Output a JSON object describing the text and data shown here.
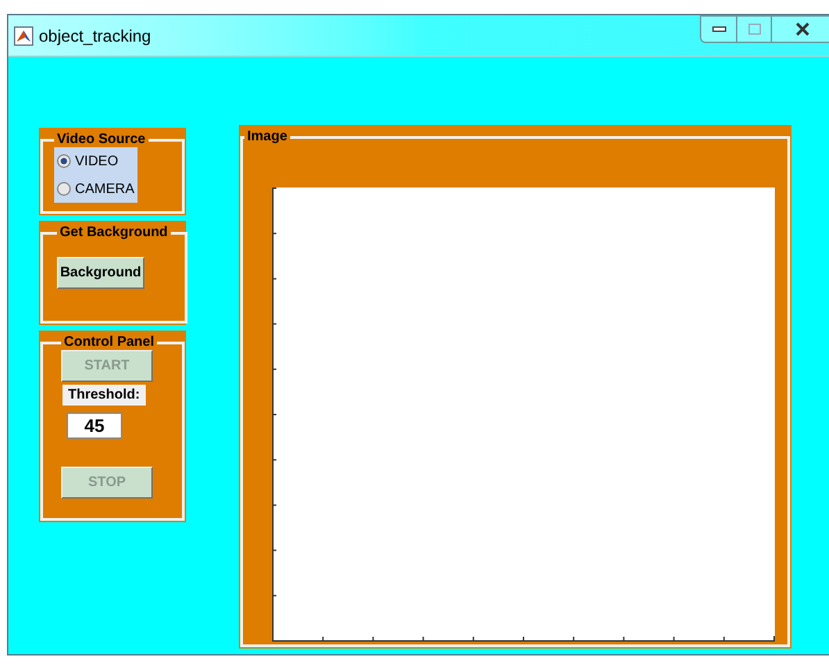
{
  "window": {
    "title": "object_tracking"
  },
  "video_source": {
    "title": "Video Source",
    "options": [
      {
        "label": "VIDEO",
        "selected": true
      },
      {
        "label": "CAMERA",
        "selected": false
      }
    ]
  },
  "get_background": {
    "title": "Get Background",
    "button": {
      "label": "Background",
      "disabled": false
    }
  },
  "control_panel": {
    "title": "Control Panel",
    "start_button": {
      "label": "START",
      "disabled": true
    },
    "threshold_label": "Threshold:",
    "threshold_value": "45",
    "stop_button": {
      "label": "STOP",
      "disabled": true
    }
  },
  "image_panel": {
    "title": "Image"
  }
}
